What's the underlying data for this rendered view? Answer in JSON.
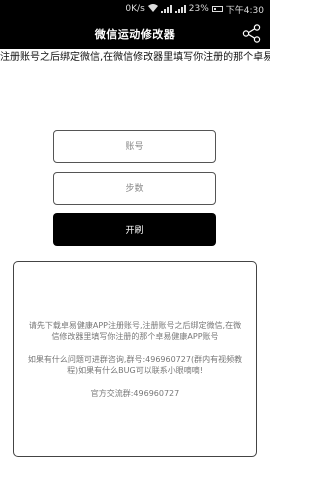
{
  "status_bar": {
    "speed": "0K/s",
    "battery": "23%",
    "time": "下午4:30"
  },
  "app_bar": {
    "title": "微信运动修改器"
  },
  "marquee": {
    "text": "注册账号之后绑定微信,在微信修改器里填写你注册的那个卓易健康A"
  },
  "form": {
    "account_placeholder": "账号",
    "account_value": "",
    "steps_placeholder": "步数",
    "steps_value": "",
    "start_label": "开刷"
  },
  "info": {
    "paragraph1": "请先下载卓易健康APP注册账号,注册账号之后绑定微信,在微信修改器里填写你注册的那个卓易健康APP账号",
    "paragraph2": "如果有什么问题可进群咨询,群号:496960727(群内有视频教程)如果有什么BUG可以联系小眼嘀嘀!",
    "paragraph3": "官方交流群:496960727"
  }
}
